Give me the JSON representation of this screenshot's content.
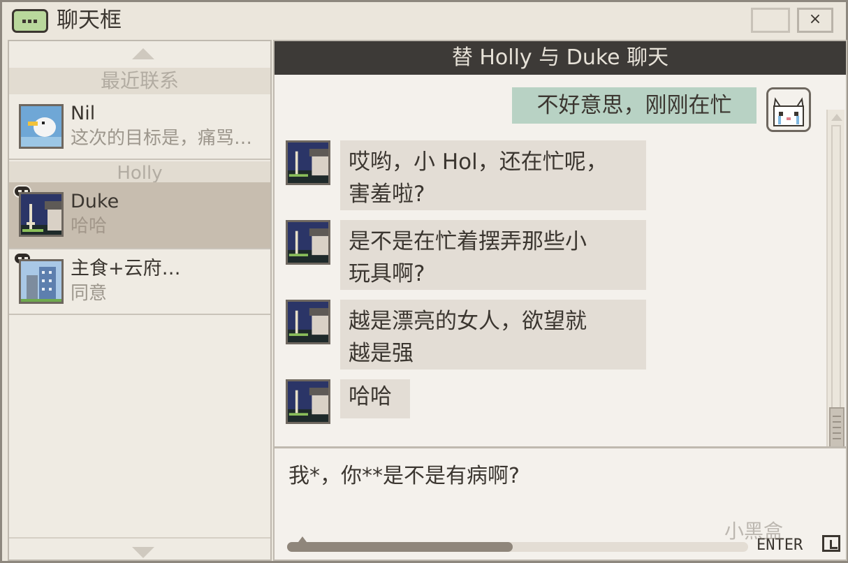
{
  "window": {
    "title": "聊天框",
    "close_label": "×"
  },
  "sidebar": {
    "section_recent": "最近联系",
    "section_holly": "Holly",
    "contacts": [
      {
        "name": "Nil",
        "preview": "这次的目标是，痛骂…"
      },
      {
        "name": "Duke",
        "preview": "哈哈"
      },
      {
        "name": "主食+云府…",
        "preview": "同意"
      }
    ]
  },
  "chat": {
    "header": "替 Holly 与 Duke 聊天",
    "messages": [
      {
        "from": "self",
        "text": "不好意思，刚刚在忙"
      },
      {
        "from": "duke",
        "text": "哎哟，小 Hol，还在忙呢，\n害羞啦?"
      },
      {
        "from": "duke",
        "text": "是不是在忙着摆弄那些小\n玩具啊?"
      },
      {
        "from": "duke",
        "text": "越是漂亮的女人，欲望就\n越是强"
      },
      {
        "from": "duke",
        "text": "哈哈"
      }
    ]
  },
  "input": {
    "value": "我*，你**是不是有病啊?",
    "typing_progress": 0.49,
    "enter_label": "ENTER"
  },
  "watermark": "小黑盒",
  "colors": {
    "header_bg": "#3d3a37",
    "outgoing_bubble": "#b8d2c4",
    "incoming_bubble": "#e3ddd5",
    "active_contact": "#c7bdaf"
  }
}
